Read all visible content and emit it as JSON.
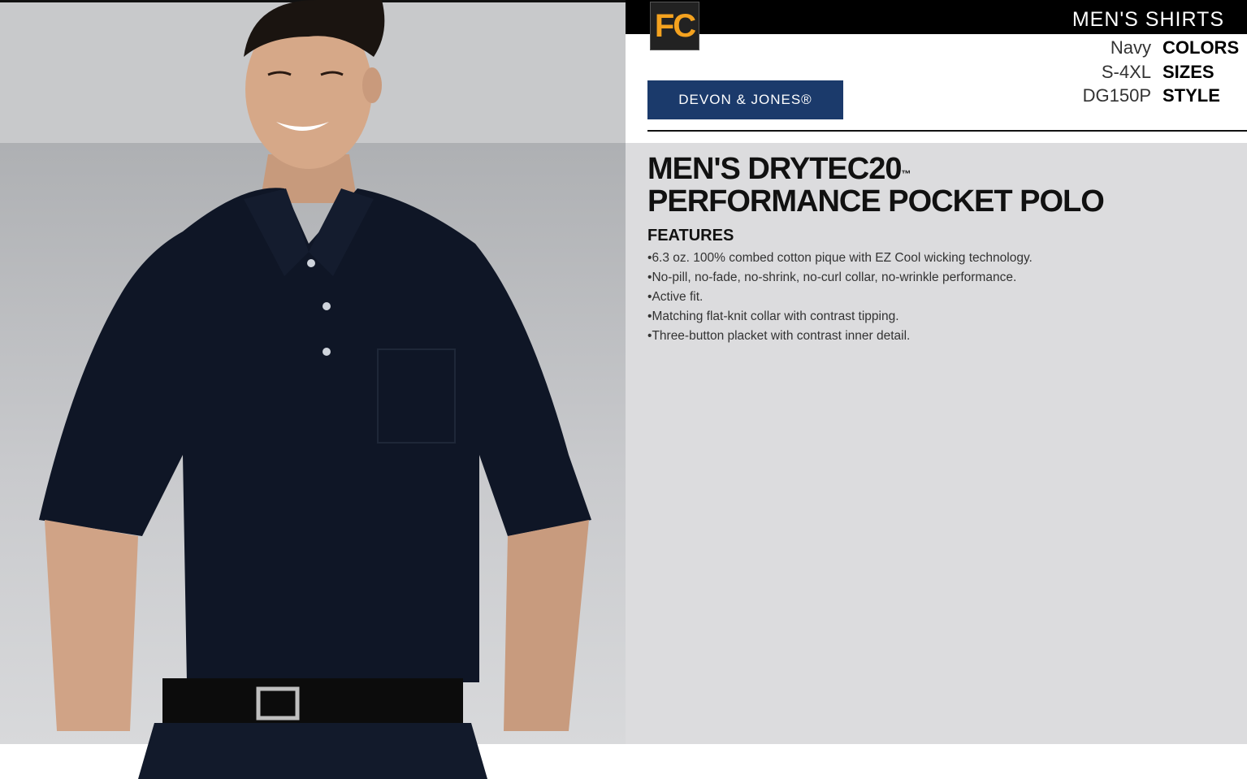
{
  "header": {
    "category": "MEN'S SHIRTS",
    "badge": "FC"
  },
  "brand": {
    "logo_text": "DEVON & JONES®"
  },
  "specs": {
    "colors": {
      "value": "Navy",
      "label": "COLORS"
    },
    "sizes": {
      "value": "S-4XL",
      "label": "SIZES"
    },
    "style": {
      "value": "DG150P",
      "label": "STYLE"
    }
  },
  "product": {
    "title_line1": "MEN'S DRYTEC20",
    "trademark": "™",
    "title_line2": "PERFORMANCE POCKET POLO"
  },
  "features": {
    "label": "FEATURES",
    "items": [
      "6.3 oz. 100% combed cotton pique with EZ Cool wicking technology.",
      "No-pill, no-fade, no-shrink, no-curl collar, no-wrinkle performance.",
      "Active fit.",
      "Matching flat-knit collar with contrast tipping.",
      "Three-button placket with contrast inner detail."
    ]
  },
  "colors": {
    "header_bg": "#000000",
    "panel_bg": "#dcdcde",
    "shirt": "#0f1626",
    "badge_accent": "#f4a21f",
    "logo_bg": "#1b3a6b"
  }
}
